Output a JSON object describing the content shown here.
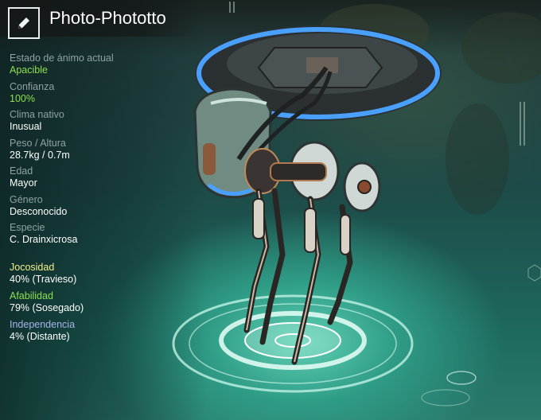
{
  "header": {
    "title": "Photo-Phototto",
    "edit_icon": "pencil-icon"
  },
  "stats": [
    {
      "label": "Estado de ánimo actual",
      "value": "Apacible",
      "value_color": "#8ee04f"
    },
    {
      "label": "Confianza",
      "value": "100%",
      "value_color": "#8ee04f"
    },
    {
      "label": "Clima nativo",
      "value": "Inusual",
      "value_color": "#ffffff"
    },
    {
      "label": "Peso / Altura",
      "value": "28.7kg / 0.7m",
      "value_color": "#ffffff"
    },
    {
      "label": "Edad",
      "value": "Mayor",
      "value_color": "#ffffff"
    },
    {
      "label": "Género",
      "value": "Desconocido",
      "value_color": "#ffffff"
    },
    {
      "label": "Especie",
      "value": "C. Drainxicrosa",
      "value_color": "#ffffff"
    }
  ],
  "traits": [
    {
      "label": "Jocosidad",
      "value": "40% (Travieso)",
      "label_color": "#f3ef8a"
    },
    {
      "label": "Afabilidad",
      "value": "79% (Sosegado)",
      "label_color": "#8ee04f"
    },
    {
      "label": "Independencia",
      "value": "4% (Distante)",
      "label_color": "#a7b3ec"
    }
  ]
}
